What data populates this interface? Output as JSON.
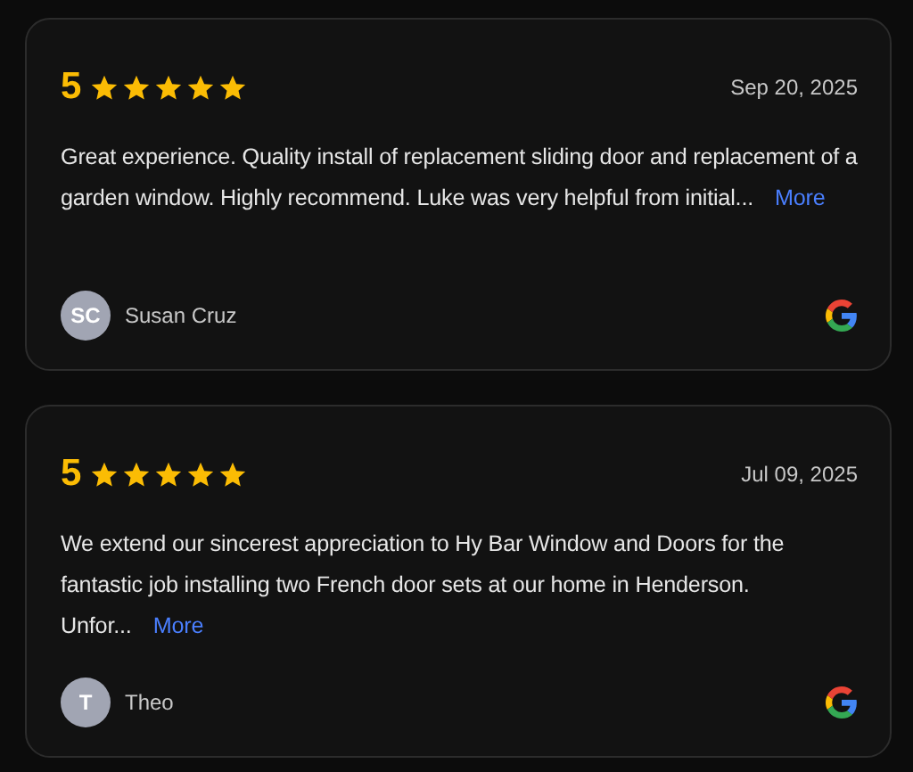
{
  "reviews": [
    {
      "rating": "5",
      "stars": 5,
      "date": "Sep 20, 2025",
      "text": "Great experience. Quality install of replacement sliding door and replacement of a garden window. Highly recommend. Luke was very helpful from initial...",
      "more": "More",
      "initials": "SC",
      "author": "Susan Cruz"
    },
    {
      "rating": "5",
      "stars": 5,
      "date": "Jul 09, 2025",
      "text": "We extend our sincerest appreciation to Hy Bar Window and Doors for the fantastic job installing two French door sets at our home in Henderson. Unfor...",
      "more": "More",
      "initials": "T",
      "author": "Theo"
    }
  ]
}
